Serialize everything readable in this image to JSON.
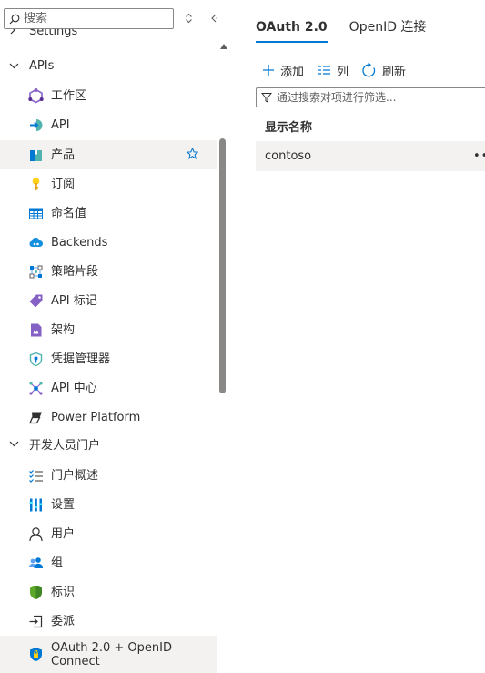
{
  "search": {
    "placeholder": "搜索"
  },
  "sidebar": {
    "cutoff_label": "Settings",
    "apis_group": "APIs",
    "apis_items": [
      {
        "label": "工作区",
        "icon": "workspace-icon"
      },
      {
        "label": "API",
        "icon": "api-icon"
      },
      {
        "label": "产品",
        "icon": "product-icon",
        "selected": true
      },
      {
        "label": "订阅",
        "icon": "key-icon"
      },
      {
        "label": "命名值",
        "icon": "named-values-icon"
      },
      {
        "label": "Backends",
        "icon": "cloud-icon"
      },
      {
        "label": "策略片段",
        "icon": "policy-fragments-icon"
      },
      {
        "label": "API 标记",
        "icon": "tag-icon"
      },
      {
        "label": "架构",
        "icon": "schema-icon"
      },
      {
        "label": "凭据管理器",
        "icon": "credential-manager-icon"
      },
      {
        "label": "API 中心",
        "icon": "api-center-icon"
      },
      {
        "label": "Power Platform",
        "icon": "power-platform-icon"
      }
    ],
    "portal_group": "开发人员门户",
    "portal_items": [
      {
        "label": "门户概述",
        "icon": "portal-overview-icon"
      },
      {
        "label": "设置",
        "icon": "settings-bars-icon"
      },
      {
        "label": "用户",
        "icon": "user-icon"
      },
      {
        "label": "组",
        "icon": "group-icon"
      },
      {
        "label": "标识",
        "icon": "identity-icon"
      },
      {
        "label": "委派",
        "icon": "delegation-icon"
      },
      {
        "label": "OAuth 2.0 + OpenID Connect",
        "icon": "oauth-icon",
        "selected": true
      }
    ]
  },
  "main": {
    "tabs": [
      {
        "label": "OAuth 2.0",
        "active": true
      },
      {
        "label": "OpenID 连接",
        "active": false
      }
    ],
    "toolbar": {
      "add": "添加",
      "columns": "列",
      "refresh": "刷新"
    },
    "filter_placeholder": "通过搜索对项进行筛选...",
    "column_header": "显示名称",
    "rows": [
      {
        "name": "contoso"
      }
    ]
  },
  "colors": {
    "accent": "#0078d4",
    "selected_bg": "#f3f2f1"
  }
}
